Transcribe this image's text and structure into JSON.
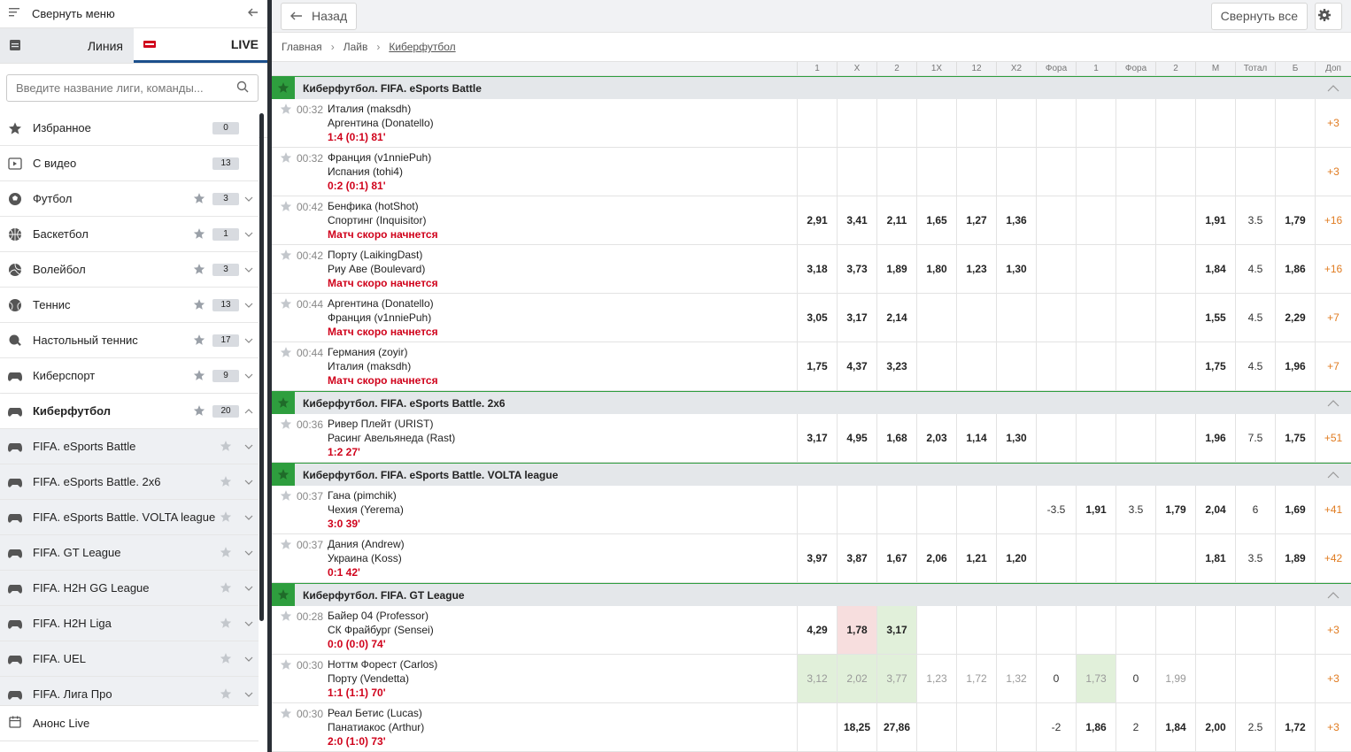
{
  "sidebar": {
    "collapse_label": "Свернуть меню",
    "tab_line": "Линия",
    "tab_live": "LIVE",
    "search_placeholder": "Введите название лиги, команды...",
    "items": [
      {
        "label": "Избранное",
        "count": "0",
        "icon": "star-icon"
      },
      {
        "label": "С видео",
        "count": "13",
        "icon": "video-icon"
      },
      {
        "label": "Футбол",
        "count": "3",
        "icon": "football-icon"
      },
      {
        "label": "Баскетбол",
        "count": "1",
        "icon": "basketball-icon"
      },
      {
        "label": "Волейбол",
        "count": "3",
        "icon": "volleyball-icon"
      },
      {
        "label": "Теннис",
        "count": "13",
        "icon": "tennis-icon"
      },
      {
        "label": "Настольный теннис",
        "count": "17",
        "icon": "table-tennis-icon"
      },
      {
        "label": "Киберспорт",
        "count": "9",
        "icon": "gamepad-icon"
      },
      {
        "label": "Киберфутбол",
        "count": "20",
        "icon": "gamepad-icon"
      }
    ],
    "subitems": [
      {
        "label": "FIFA. eSports Battle"
      },
      {
        "label": "FIFA. eSports Battle. 2x6"
      },
      {
        "label": "FIFA. eSports Battle. VOLTA league"
      },
      {
        "label": "FIFA. GT League"
      },
      {
        "label": "FIFA. H2H GG League"
      },
      {
        "label": "FIFA. H2H Liga"
      },
      {
        "label": "FIFA. UEL"
      },
      {
        "label": "FIFA. Лига Про"
      }
    ],
    "bottom_label": "Анонс Live"
  },
  "topbar": {
    "back_label": "Назад",
    "collapse_all_label": "Свернуть все"
  },
  "breadcrumbs": [
    "Главная",
    "Лайв",
    "Киберфутбол"
  ],
  "columns": [
    "1",
    "X",
    "2",
    "1X",
    "12",
    "X2",
    "Фора",
    "1",
    "Фора",
    "2",
    "М",
    "Тотал",
    "Б",
    "Доп"
  ],
  "groups": [
    {
      "title": "Киберфутбол. FIFA. eSports Battle",
      "matches": [
        {
          "time": "00:32",
          "team1": "Италия (maksdh)",
          "team2": "Аргентина (Donatello)",
          "status": "1:4 (0:1) 81'",
          "odds": [
            "",
            "",
            "",
            "",
            "",
            "",
            "",
            "",
            "",
            "",
            "",
            "",
            ""
          ],
          "more": "+3"
        },
        {
          "time": "00:32",
          "team1": "Франция (v1nniePuh)",
          "team2": "Испания (tohi4)",
          "status": "0:2 (0:1) 81'",
          "odds": [
            "",
            "",
            "",
            "",
            "",
            "",
            "",
            "",
            "",
            "",
            "",
            "",
            ""
          ],
          "more": "+3"
        },
        {
          "time": "00:42",
          "team1": "Бенфика (hotShot)",
          "team2": "Спортинг (Inquisitor)",
          "status": "Матч скоро начнется",
          "odds": [
            "2,91",
            "3,41",
            "2,11",
            "1,65",
            "1,27",
            "1,36",
            "",
            "",
            "",
            "",
            "1,91",
            "3.5",
            "1,79"
          ],
          "more": "+16"
        },
        {
          "time": "00:42",
          "team1": "Порту (LaikingDast)",
          "team2": "Риу Аве (Boulevard)",
          "status": "Матч скоро начнется",
          "odds": [
            "3,18",
            "3,73",
            "1,89",
            "1,80",
            "1,23",
            "1,30",
            "",
            "",
            "",
            "",
            "1,84",
            "4.5",
            "1,86"
          ],
          "more": "+16"
        },
        {
          "time": "00:44",
          "team1": "Аргентина (Donatello)",
          "team2": "Франция (v1nniePuh)",
          "status": "Матч скоро начнется",
          "odds": [
            "3,05",
            "3,17",
            "2,14",
            "",
            "",
            "",
            "",
            "",
            "",
            "",
            "1,55",
            "4.5",
            "2,29"
          ],
          "more": "+7"
        },
        {
          "time": "00:44",
          "team1": "Германия (zoyir)",
          "team2": "Италия (maksdh)",
          "status": "Матч скоро начнется",
          "odds": [
            "1,75",
            "4,37",
            "3,23",
            "",
            "",
            "",
            "",
            "",
            "",
            "",
            "1,75",
            "4.5",
            "1,96"
          ],
          "more": "+7"
        }
      ]
    },
    {
      "title": "Киберфутбол. FIFA. eSports Battle. 2x6",
      "matches": [
        {
          "time": "00:36",
          "team1": "Ривер Плейт (URIST)",
          "team2": "Расинг Авельянеда (Rast)",
          "status": "1:2 27'",
          "odds": [
            "3,17",
            "4,95",
            "1,68",
            "2,03",
            "1,14",
            "1,30",
            "",
            "",
            "",
            "",
            "1,96",
            "7.5",
            "1,75"
          ],
          "more": "+51"
        }
      ]
    },
    {
      "title": "Киберфутбол. FIFA. eSports Battle. VOLTA league",
      "matches": [
        {
          "time": "00:37",
          "team1": "Гана (pimchik)",
          "team2": "Чехия (Yerema)",
          "status": "3:0 39'",
          "odds": [
            "",
            "",
            "",
            "",
            "",
            "",
            "-3.5",
            "1,91",
            "3.5",
            "1,79",
            "2,04",
            "6",
            "1,69"
          ],
          "more": "+41"
        },
        {
          "time": "00:37",
          "team1": "Дания (Andrew)",
          "team2": "Украина (Koss)",
          "status": "0:1 42'",
          "odds": [
            "3,97",
            "3,87",
            "1,67",
            "2,06",
            "1,21",
            "1,20",
            "",
            "",
            "",
            "",
            "1,81",
            "3.5",
            "1,89"
          ],
          "more": "+42"
        }
      ]
    },
    {
      "title": "Киберфутбол. FIFA. GT League",
      "matches": [
        {
          "time": "00:28",
          "team1": "Байер 04 (Professor)",
          "team2": "СК Фрайбург (Sensei)",
          "status": "0:0 (0:0) 74'",
          "odds": [
            "4,29",
            "1,78",
            "3,17",
            "",
            "",
            "",
            "",
            "",
            "",
            "",
            "",
            "",
            ""
          ],
          "more": "+3"
        },
        {
          "time": "00:30",
          "team1": "Ноттм Форест (Carlos)",
          "team2": "Порту (Vendetta)",
          "status": "1:1 (1:1) 70'",
          "odds": [
            "3,12",
            "2,02",
            "3,77",
            "1,23",
            "1,72",
            "1,32",
            "0",
            "1,73",
            "0",
            "1,99",
            "",
            "",
            ""
          ],
          "more": "+3"
        },
        {
          "time": "00:30",
          "team1": "Реал Бетис (Lucas)",
          "team2": "Панатиакос (Arthur)",
          "status": "2:0 (1:0) 73'",
          "odds": [
            "",
            "18,25",
            "27,86",
            "",
            "",
            "",
            "-2",
            "1,86",
            "2",
            "1,84",
            "2,00",
            "2.5",
            "1,72"
          ],
          "more": "+3"
        }
      ]
    }
  ],
  "colors": {
    "accent": "#2e9e3e",
    "live_score": "#d0021b",
    "more": "#e07b20",
    "up": "#e1f0da",
    "down": "#f7dede"
  }
}
